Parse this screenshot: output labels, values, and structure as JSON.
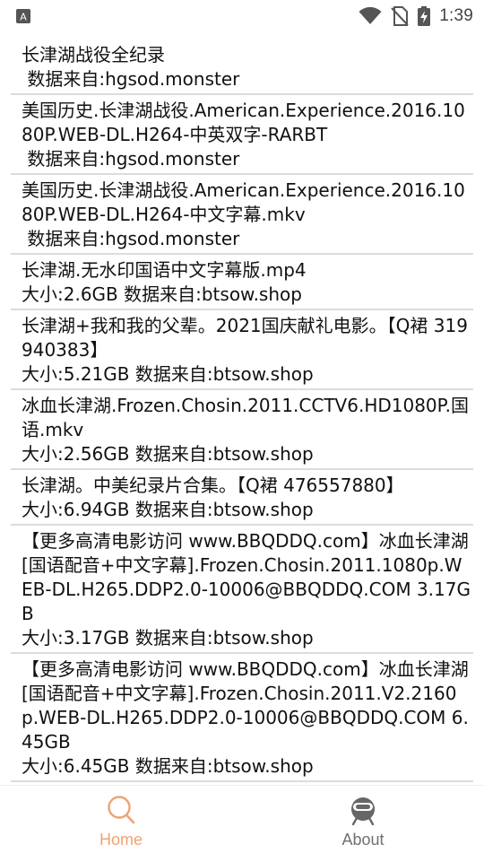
{
  "status_bar": {
    "time": "1:39",
    "left_icon": "a-badge-icon",
    "icons": [
      "wifi-icon",
      "no-sim-icon",
      "battery-charging-icon"
    ]
  },
  "results": [
    {
      "title": "长津湖战役全纪录",
      "meta": " 数据来自:hgsod.monster"
    },
    {
      "title": "美国历史.长津湖战役.American.Experience.2016.1080P.WEB-DL.H264-中英双字-RARBT",
      "meta": " 数据来自:hgsod.monster"
    },
    {
      "title": "美国历史.长津湖战役.American.Experience.2016.1080P.WEB-DL.H264-中文字幕.mkv",
      "meta": " 数据来自:hgsod.monster"
    },
    {
      "title": "长津湖.无水印国语中文字幕版.mp4",
      "meta": "大小:2.6GB 数据来自:btsow.shop"
    },
    {
      "title": "长津湖+我和我的父辈。2021国庆献礼电影。【Q裙 319940383】",
      "meta": "大小:5.21GB 数据来自:btsow.shop"
    },
    {
      "title": "冰血长津湖.Frozen.Chosin.2011.CCTV6.HD1080P.国语.mkv",
      "meta": "大小:2.56GB 数据来自:btsow.shop"
    },
    {
      "title": "长津湖。中美纪录片合集。【Q裙 476557880】",
      "meta": "大小:6.94GB 数据来自:btsow.shop"
    },
    {
      "title": "【更多高清电影访问 www.BBQDDQ.com】冰血长津湖[国语配音+中文字幕].Frozen.Chosin.2011.1080p.WEB-DL.H265.DDP2.0-10006@BBQDDQ.COM 3.17GB",
      "meta": "大小:3.17GB 数据来自:btsow.shop"
    },
    {
      "title": "【更多高清电影访问 www.BBQDDQ.com】冰血长津湖[国语配音+中文字幕].Frozen.Chosin.2011.V2.2160p.WEB-DL.H265.DDP2.0-10006@BBQDDQ.COM 6.45GB",
      "meta": "大小:6.45GB 数据来自:btsow.shop"
    }
  ],
  "tabs": [
    {
      "label": "Home",
      "icon": "search-icon",
      "active": true
    },
    {
      "label": "About",
      "icon": "robot-icon",
      "active": false
    }
  ],
  "colors": {
    "accent": "#f0a274",
    "inactive": "#707070",
    "divider": "#dcdcdc"
  }
}
